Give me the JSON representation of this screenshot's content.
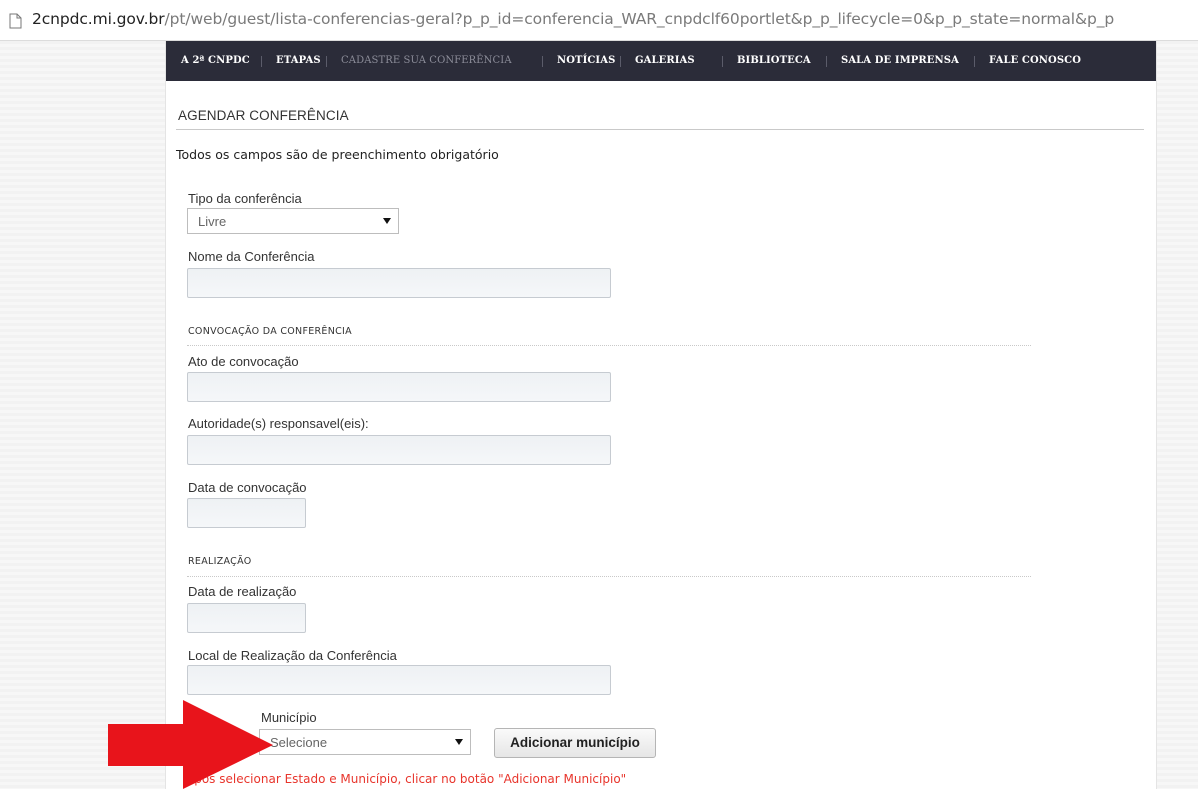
{
  "browser": {
    "url_host": "2cnpdc.mi.gov.br",
    "url_rest": "/pt/web/guest/lista-conferencias-geral?p_p_id=conferencia_WAR_cnpdclf60portlet&p_p_lifecycle=0&p_p_state=normal&p_p"
  },
  "nav": {
    "items": [
      "A 2ª CNPDC",
      "ETAPAS",
      "CADASTRE SUA CONFERÊNCIA",
      "NOTÍCIAS",
      "GALERIAS",
      "BIBLIOTECA",
      "SALA DE IMPRENSA",
      "FALE CONOSCO"
    ]
  },
  "form": {
    "title": "AGENDAR CONFERÊNCIA",
    "required_note": "Todos os campos são de preenchimento obrigatório",
    "tipo_label": "Tipo da conferência",
    "tipo_value": "Livre",
    "nome_label": "Nome da Conferência",
    "convocacao_section": "CONVOCAÇÃO DA CONFERÊNCIA",
    "ato_label": "Ato de convocação",
    "autoridade_label": "Autoridade(s) responsavel(eis):",
    "data_convocacao_label": "Data de convocação",
    "realizacao_section": "REALIZAÇÃO",
    "data_realizacao_label": "Data de realização",
    "local_label": "Local de Realização da Conferência",
    "municipio_label": "Município",
    "municipio_value": "Selecione",
    "add_municipio_button": "Adicionar município",
    "hint": "Após selecionar Estado e Município, clicar no botão \"Adicionar Município\""
  },
  "colors": {
    "nav_bg": "#2b2c39",
    "hint": "#e8352c",
    "arrow": "#e8141b"
  },
  "icons": {
    "page": "page-icon",
    "dropdown": "chevron-down-icon",
    "annotation": "red-arrow"
  }
}
